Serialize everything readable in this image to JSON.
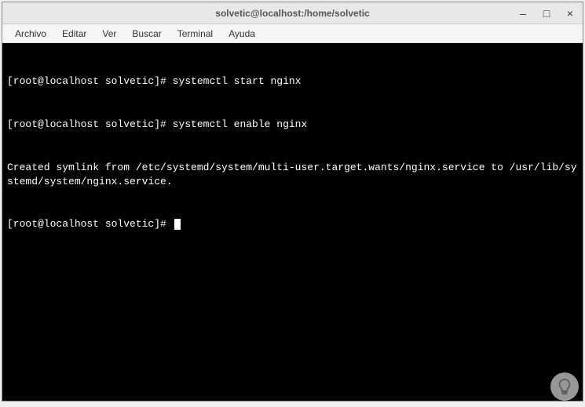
{
  "window": {
    "title": "solvetic@localhost:/home/solvetic"
  },
  "menu": {
    "items": [
      {
        "label": "Archivo"
      },
      {
        "label": "Editar"
      },
      {
        "label": "Ver"
      },
      {
        "label": "Buscar"
      },
      {
        "label": "Terminal"
      },
      {
        "label": "Ayuda"
      }
    ]
  },
  "terminal": {
    "lines": [
      {
        "prompt": "[root@localhost solvetic]#",
        "command": " systemctl start nginx"
      },
      {
        "prompt": "[root@localhost solvetic]#",
        "command": " systemctl enable nginx"
      },
      {
        "output": "Created symlink from /etc/systemd/system/multi-user.target.wants/nginx.service to /usr/lib/systemd/system/nginx.service."
      },
      {
        "prompt": "[root@localhost solvetic]#",
        "command": " ",
        "cursor": true
      }
    ]
  },
  "controls": {
    "minimize": "–",
    "maximize": "□",
    "close": "×"
  }
}
